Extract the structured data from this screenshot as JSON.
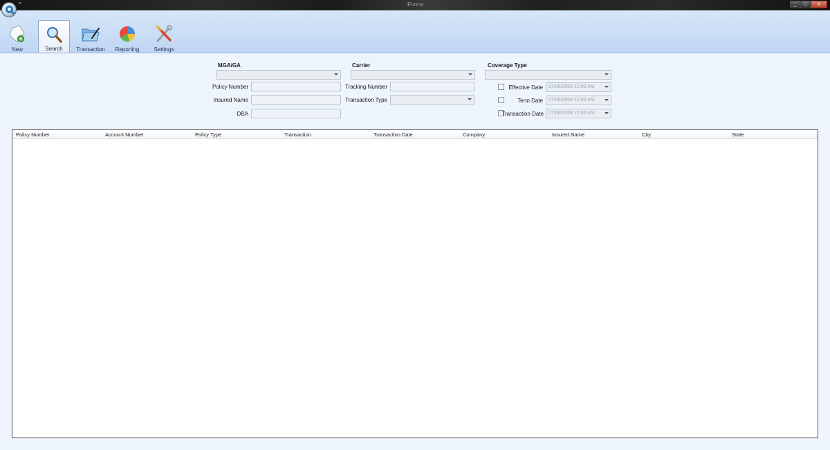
{
  "window": {
    "title": "iForms",
    "qat_glyph": "=",
    "minimize": "_",
    "maximize": "□",
    "close": "x"
  },
  "ribbon": {
    "buttons": [
      {
        "label": "New",
        "icon": "new-document-icon"
      },
      {
        "label": "Search",
        "icon": "search-icon",
        "active": true
      },
      {
        "label": "Transaction",
        "icon": "folder-icon"
      },
      {
        "label": "Reporting",
        "icon": "pie-chart-icon"
      },
      {
        "label": "Settings",
        "icon": "tools-icon"
      }
    ]
  },
  "search_form": {
    "mga_header": "MGA/GA",
    "carrier_header": "Carrier",
    "coverage_header": "Coverage Type",
    "policy_number_label": "Policy Number",
    "insured_name_label": "Insured Name",
    "dba_label": "DBA",
    "tracking_number_label": "Tracking Number",
    "transaction_type_label": "Transaction Type",
    "effective_date_label": "Effective Date",
    "term_date_label": "Term Date",
    "transaction_date_label": "Transaction Date",
    "effective_date_value": "07/06/2009 12:00 AM",
    "term_date_value": "07/06/2009 12:00 AM",
    "transaction_date_value": "07/06/2009 12:00 AM"
  },
  "results_grid": {
    "columns": [
      "Policy Number",
      "Account Number",
      "Policy Type",
      "Transaction",
      "Transaction Date",
      "Company",
      "Insured Name",
      "City",
      "State"
    ],
    "rows": []
  },
  "colors": {
    "ribbon": "#c9dcf5",
    "form_background": "#eef4fb",
    "accent": "#2a78c4"
  }
}
